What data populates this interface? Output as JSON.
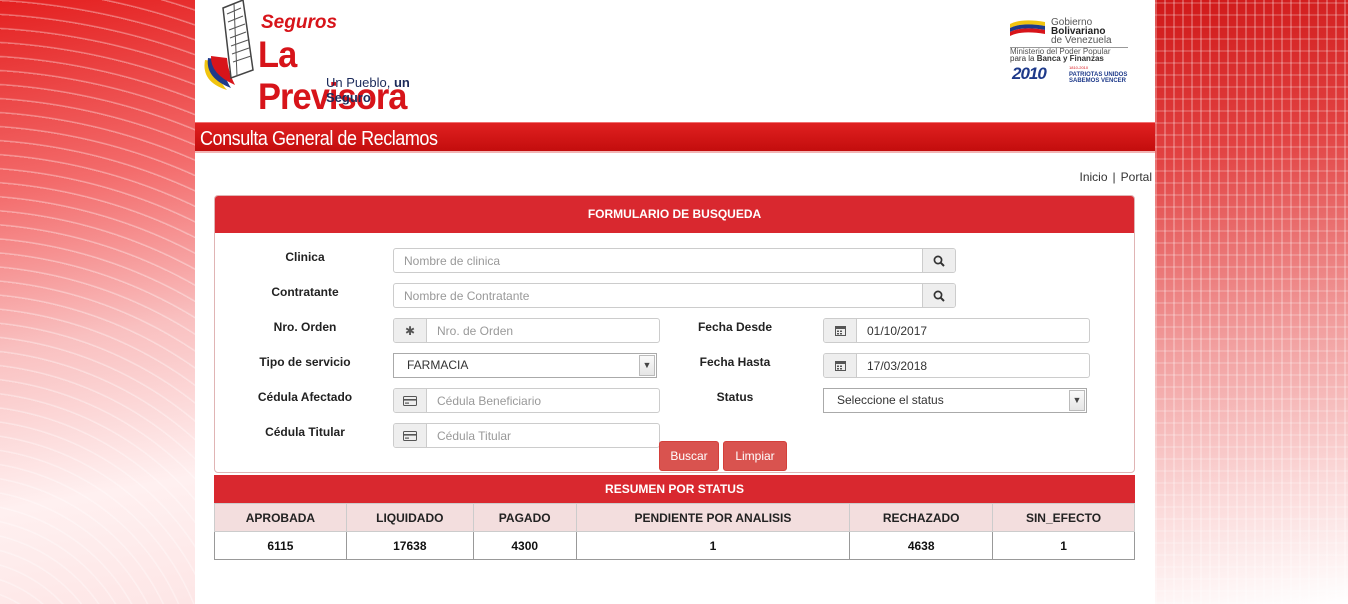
{
  "brand": {
    "small": "Seguros",
    "name": "La Previsora",
    "slogan_part1": "Un Pueblo,",
    "slogan_part2": "un Seguro"
  },
  "gov": {
    "line1": "Gobierno",
    "line2": "Bolivariano",
    "line3": "de Venezuela",
    "line4": "Ministerio del Poder Popular",
    "line5_a": "para la",
    "line5_b": "Banca y Finanzas",
    "year": "2010",
    "slogan_a": "PATRIOTAS UNIDOS",
    "slogan_b": "SABEMOS VENCER",
    "small": "1810-2010"
  },
  "page_title": "Consulta General de Reclamos",
  "top_links": {
    "inicio": "Inicio",
    "separator": "|",
    "portal": "Portal"
  },
  "form": {
    "title": "FORMULARIO DE BUSQUEDA",
    "labels": {
      "clinica": "Clinica",
      "contratante": "Contratante",
      "nro_orden": "Nro. Orden",
      "tipo_servicio": "Tipo de servicio",
      "cedula_afectado": "Cédula Afectado",
      "cedula_titular": "Cédula Titular",
      "fecha_desde": "Fecha Desde",
      "fecha_hasta": "Fecha Hasta",
      "status": "Status"
    },
    "placeholders": {
      "clinica": "Nombre de clinica",
      "contratante": "Nombre de Contratante",
      "nro_orden": "Nro. de Orden",
      "cedula_afectado": "Cédula Beneficiario",
      "cedula_titular": "Cédula Titular"
    },
    "values": {
      "fecha_desde": "01/10/2017",
      "fecha_hasta": "17/03/2018",
      "tipo_servicio": "FARMACIA",
      "status": "Seleccione el status"
    },
    "buttons": {
      "buscar": "Buscar",
      "limpiar": "Limpiar"
    }
  },
  "summary": {
    "title": "RESUMEN POR STATUS",
    "headers": [
      "APROBADA",
      "LIQUIDADO",
      "PAGADO",
      "PENDIENTE POR ANALISIS",
      "RECHAZADO",
      "SIN_EFECTO"
    ],
    "values": [
      "6115",
      "17638",
      "4300",
      "1",
      "4638",
      "1"
    ]
  },
  "icons": {
    "search": "search-icon",
    "asterisk": "asterisk-icon",
    "calendar": "calendar-icon",
    "id_card": "id-card-icon",
    "dropdown": "chevron-down-icon"
  },
  "colors": {
    "accent": "#d9282f",
    "button": "#d9534f",
    "table_header": "#f3dede"
  }
}
